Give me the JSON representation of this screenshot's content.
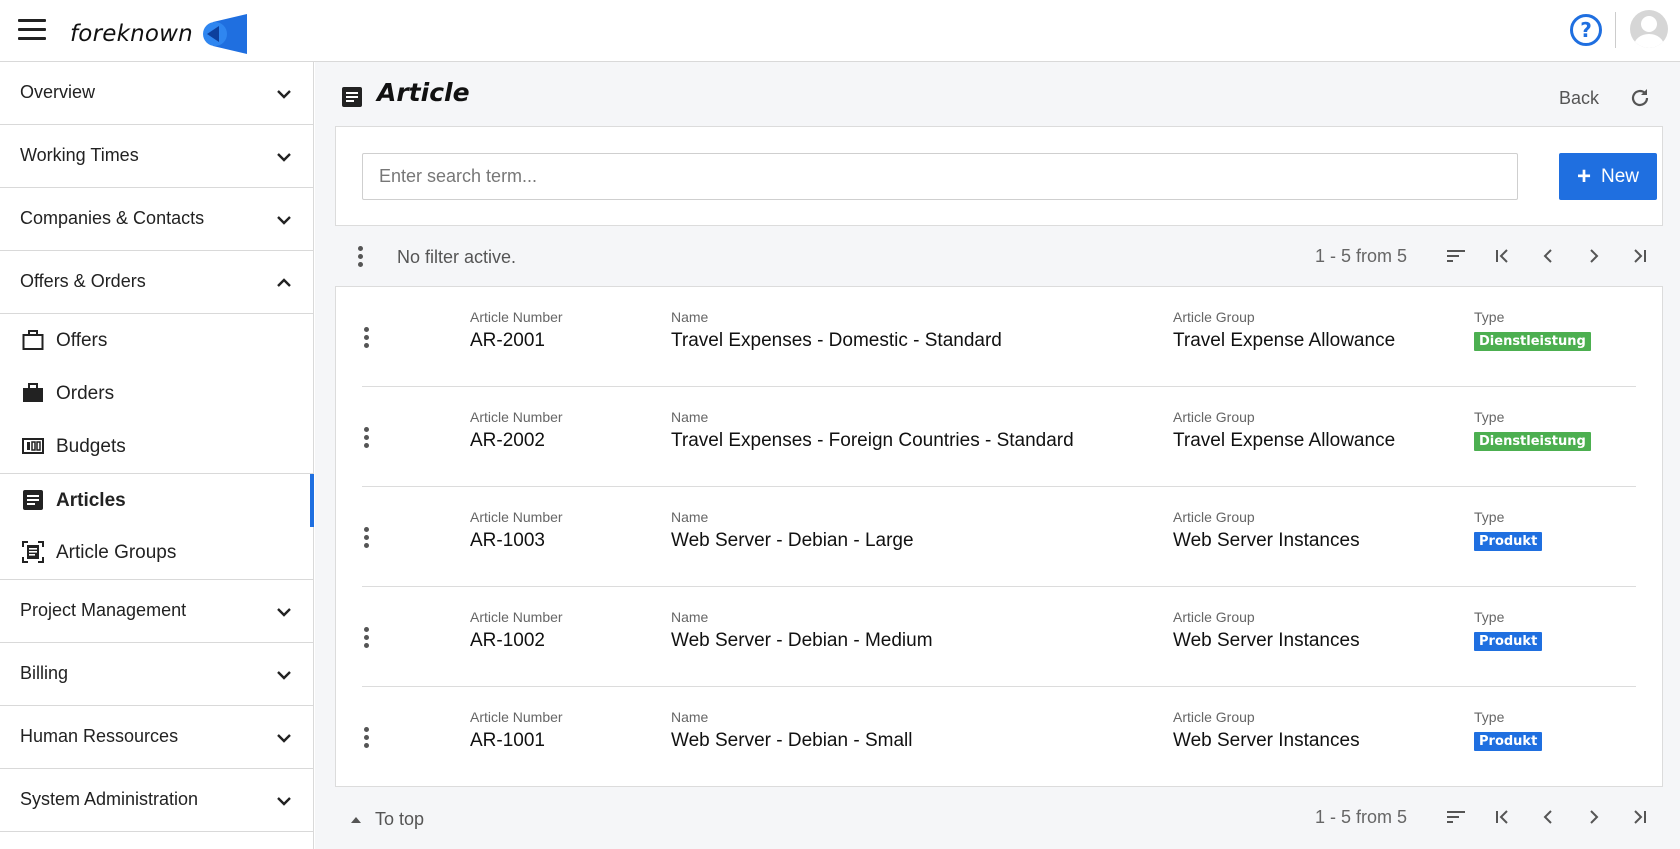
{
  "app": {
    "brand": "foreknown",
    "colors": {
      "accent": "#1f6fe0",
      "service": "#4caf50",
      "product": "#1f6fe0"
    }
  },
  "sidebar": {
    "sections": [
      {
        "label": "Overview",
        "expanded": false
      },
      {
        "label": "Working Times",
        "expanded": false
      },
      {
        "label": "Companies & Contacts",
        "expanded": false
      },
      {
        "label": "Offers & Orders",
        "expanded": true
      }
    ],
    "subitems": [
      {
        "label": "Offers",
        "icon": "briefcase-outline-icon"
      },
      {
        "label": "Orders",
        "icon": "briefcase-icon"
      },
      {
        "label": "Budgets",
        "icon": "budget-counter-icon"
      },
      {
        "label": "Articles",
        "icon": "article-icon",
        "active": true
      },
      {
        "label": "Article Groups",
        "icon": "article-group-icon"
      }
    ],
    "sections_after": [
      {
        "label": "Project Management"
      },
      {
        "label": "Billing"
      },
      {
        "label": "Human Ressources"
      },
      {
        "label": "System Administration"
      }
    ]
  },
  "header": {
    "title": "Article",
    "back_label": "Back"
  },
  "search": {
    "placeholder": "Enter search term...",
    "new_label": "New"
  },
  "filter": {
    "text": "No filter active.",
    "range": "1 - 5 from 5"
  },
  "columns": {
    "number": "Article Number",
    "name": "Name",
    "group": "Article Group",
    "type": "Type"
  },
  "rows": [
    {
      "number": "AR-2001",
      "name": "Travel Expenses - Domestic - Standard",
      "group": "Travel Expense Allowance",
      "type": "Dienstleistung"
    },
    {
      "number": "AR-2002",
      "name": "Travel Expenses - Foreign Countries - Standard",
      "group": "Travel Expense Allowance",
      "type": "Dienstleistung"
    },
    {
      "number": "AR-1003",
      "name": "Web Server - Debian - Large",
      "group": "Web Server Instances",
      "type": "Produkt"
    },
    {
      "number": "AR-1002",
      "name": "Web Server - Debian - Medium",
      "group": "Web Server Instances",
      "type": "Produkt"
    },
    {
      "number": "AR-1001",
      "name": "Web Server - Debian - Small",
      "group": "Web Server Instances",
      "type": "Produkt"
    }
  ],
  "footer": {
    "to_top": "To top",
    "range": "1 - 5 from 5"
  }
}
